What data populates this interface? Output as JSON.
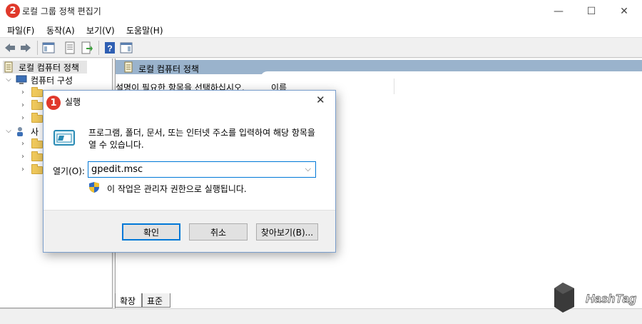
{
  "window": {
    "title": "로컬 그룹 정책 편집기",
    "controls": {
      "minimize": "—",
      "maximize": "☐",
      "close": "✕"
    }
  },
  "menu": [
    {
      "label": "파일(F)"
    },
    {
      "label": "동작(A)"
    },
    {
      "label": "보기(V)"
    },
    {
      "label": "도움말(H)"
    }
  ],
  "toolbar": {
    "icons": [
      "back-icon",
      "forward-icon",
      "show-hide-tree-icon",
      "properties-icon",
      "export-list-icon",
      "help-icon",
      "show-hide-action-pane-icon"
    ]
  },
  "tree": {
    "root": "로컬 컴퓨터 정책",
    "computer_config": "컴퓨터 구성",
    "user_config_partial": "사"
  },
  "right_pane": {
    "header": "로컬 컴퓨터 정책",
    "desc_partial": "설명이 필요한 항목을 선택하십시오.",
    "column_name": "이름"
  },
  "tabs": [
    {
      "label": "확장"
    },
    {
      "label": "표준"
    }
  ],
  "badges": {
    "step1": "1",
    "step2": "2"
  },
  "dialog": {
    "title": "실행",
    "close": "✕",
    "description": "프로그램, 폴더, 문서, 또는 인터넷 주소를 입력하여 해당 항목을 열 수 있습니다.",
    "open_label": "열기(O):",
    "open_value": "gpedit.msc",
    "admin_note": "이 작업은 관리자 권한으로 실행됩니다.",
    "buttons": {
      "ok": "확인",
      "cancel": "취소",
      "browse": "찾아보기(B)..."
    }
  },
  "watermark": {
    "text": "HashTag",
    "badge_text": "Hash Tag"
  },
  "colors": {
    "badge": "#e0392b",
    "header": "#9ab3cc",
    "accent": "#0078d7"
  }
}
